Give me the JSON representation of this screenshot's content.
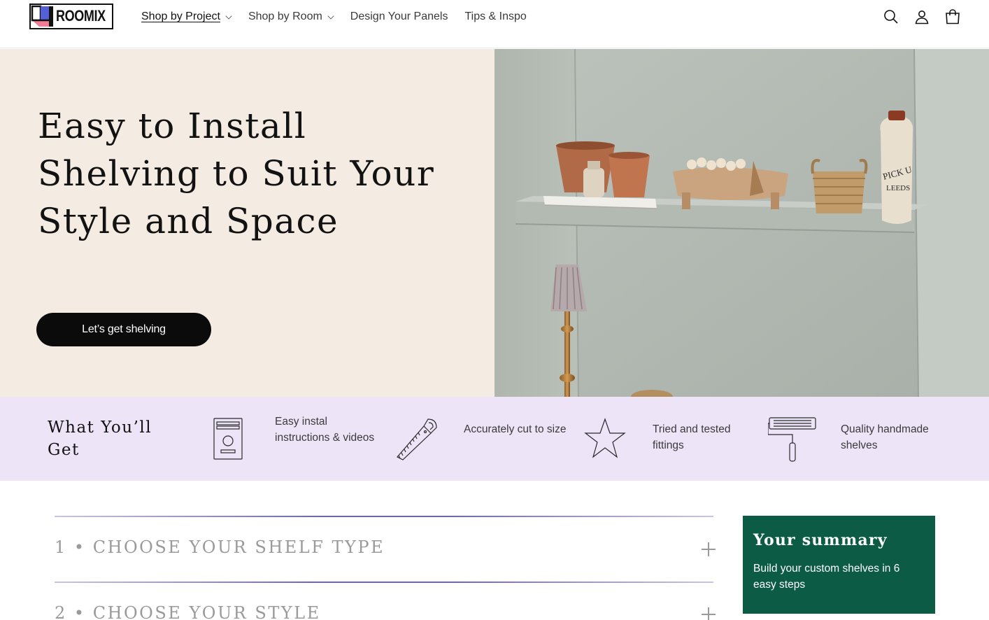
{
  "brand": {
    "name": "ROOMIX"
  },
  "nav": {
    "items": [
      {
        "label": "Shop by Project",
        "dropdown": true,
        "active": true
      },
      {
        "label": "Shop by Room",
        "dropdown": true,
        "active": false
      },
      {
        "label": "Design Your Panels",
        "dropdown": false,
        "active": false
      },
      {
        "label": "Tips & Inspo",
        "dropdown": false,
        "active": false
      }
    ],
    "icons": [
      "search-icon",
      "account-icon",
      "cart-icon"
    ]
  },
  "hero": {
    "title": "Easy to Install Shelving to Suit Your Style and Space",
    "cta_label": "Let’s get shelving",
    "background": "#f4ebe2"
  },
  "benefits": {
    "title": "What You’ll Get",
    "background": "#ede4f8",
    "items": [
      {
        "icon": "instructions-icon",
        "text": "Easy instal instructions & videos"
      },
      {
        "icon": "saw-icon",
        "text": "Accurately cut to size"
      },
      {
        "icon": "star-icon",
        "text": "Tried and tested fittings"
      },
      {
        "icon": "paint-roller-icon",
        "text": "Quality handmade shelves"
      }
    ]
  },
  "steps": [
    {
      "number": "1",
      "label": "CHOOSE YOUR SHELF TYPE"
    },
    {
      "number": "2",
      "label": "CHOOSE YOUR STYLE"
    }
  ],
  "summary": {
    "title": "Your summary",
    "text": "Build your custom shelves in 6 easy steps",
    "background": "#0c5b45"
  }
}
